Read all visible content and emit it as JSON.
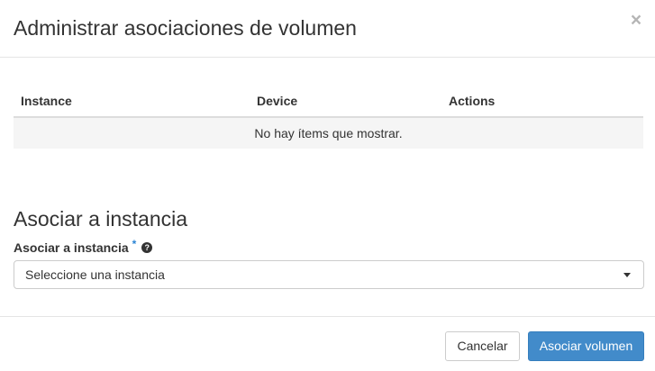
{
  "dialog": {
    "title": "Administrar asociaciones de volumen",
    "close_label": "×"
  },
  "attachments_table": {
    "columns": [
      "Instance",
      "Device",
      "Actions"
    ],
    "rows": [],
    "empty_message": "No hay ítems que mostrar."
  },
  "attach_section": {
    "heading": "Asociar a instancia",
    "field_label": "Asociar a instancia",
    "required_marker": "*",
    "help_icon": "question-circle-icon",
    "select": {
      "selected_value": "Seleccione una instancia"
    }
  },
  "footer": {
    "cancel_label": "Cancelar",
    "submit_label": "Asociar volumen"
  },
  "colors": {
    "primary": "#428bca",
    "required": "#2a84d4",
    "table_empty_bg": "#f5f5f5"
  }
}
